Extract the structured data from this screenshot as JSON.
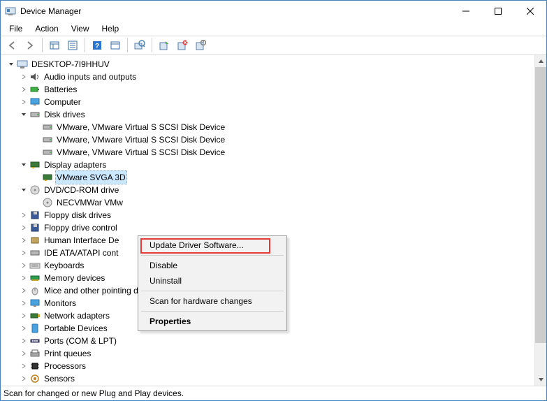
{
  "window": {
    "title": "Device Manager"
  },
  "menubar": {
    "file": "File",
    "action": "Action",
    "view": "View",
    "help": "Help"
  },
  "tree": {
    "root": "DESKTOP-7I9HHUV",
    "audio": "Audio inputs and outputs",
    "batteries": "Batteries",
    "computer": "Computer",
    "disk_drives": "Disk drives",
    "disk0": "VMware, VMware Virtual S SCSI Disk Device",
    "disk1": "VMware, VMware Virtual S SCSI Disk Device",
    "disk2": "VMware, VMware Virtual S SCSI Disk Device",
    "display": "Display adapters",
    "svga": "VMware SVGA 3D",
    "dvd": "DVD/CD-ROM drive",
    "nec": "NECVMWar VMw",
    "floppy_disk": "Floppy disk drives",
    "floppy_ctrl": "Floppy drive control",
    "hid": "Human Interface De",
    "ide": "IDE ATA/ATAPI cont",
    "kb": "Keyboards",
    "mem": "Memory devices",
    "mice": "Mice and other pointing devices",
    "monitors": "Monitors",
    "net": "Network adapters",
    "portable": "Portable Devices",
    "ports": "Ports (COM & LPT)",
    "printq": "Print queues",
    "proc": "Processors",
    "sensors": "Sensors"
  },
  "context": {
    "update": "Update Driver Software...",
    "disable": "Disable",
    "uninstall": "Uninstall",
    "scan": "Scan for hardware changes",
    "properties": "Properties"
  },
  "status": "Scan for changed or new Plug and Play devices."
}
